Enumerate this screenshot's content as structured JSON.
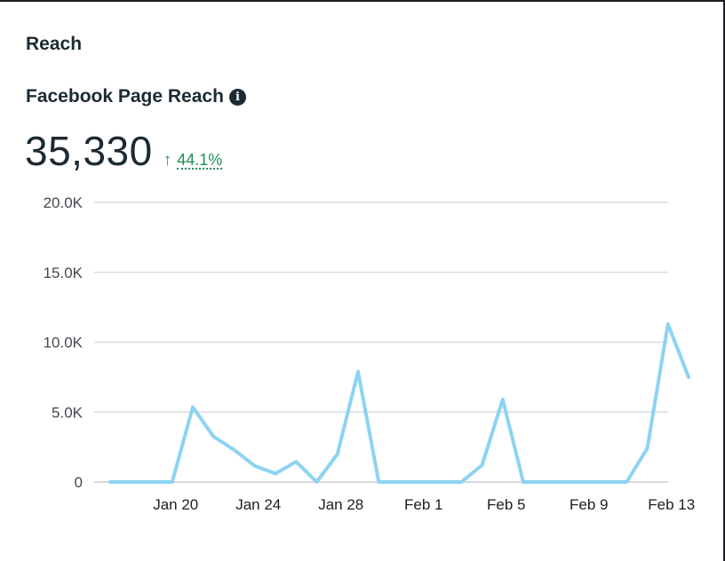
{
  "card": {
    "section_title": "Reach",
    "metric_title": "Facebook Page Reach",
    "info_icon": "info-icon",
    "total": "35,330",
    "trend_icon": "arrow-up-icon",
    "trend_arrow": "↑",
    "trend_percent": "44.1%",
    "trend_color": "#1e8f56"
  },
  "chart_data": {
    "type": "line",
    "line_color": "#8dd3f2",
    "grid": true,
    "y_ticks": [
      "0",
      "5.0K",
      "10.0K",
      "15.0K",
      "20.0K"
    ],
    "y_tick_values": [
      0,
      5000,
      10000,
      15000,
      20000
    ],
    "ylim": [
      0,
      20000
    ],
    "x_ticks": [
      "Jan 20",
      "Jan 24",
      "Jan 28",
      "Feb 1",
      "Feb 5",
      "Feb 9",
      "Feb 13"
    ],
    "x_tick_index": [
      3,
      7,
      11,
      15,
      19,
      23,
      27
    ],
    "x": [
      "Jan 17",
      "Jan 18",
      "Jan 19",
      "Jan 20",
      "Jan 21",
      "Jan 22",
      "Jan 23",
      "Jan 24",
      "Jan 25",
      "Jan 26",
      "Jan 27",
      "Jan 28",
      "Jan 29",
      "Jan 30",
      "Jan 31",
      "Feb 1",
      "Feb 2",
      "Feb 3",
      "Feb 4",
      "Feb 5",
      "Feb 6",
      "Feb 7",
      "Feb 8",
      "Feb 9",
      "Feb 10",
      "Feb 11",
      "Feb 12",
      "Feb 13",
      "Feb 14"
    ],
    "values": [
      0,
      0,
      0,
      0,
      5350,
      3250,
      2300,
      1150,
      600,
      1450,
      0,
      2000,
      7900,
      0,
      0,
      0,
      0,
      0,
      1200,
      5900,
      0,
      0,
      0,
      0,
      0,
      0,
      2400,
      11300,
      7500
    ]
  }
}
